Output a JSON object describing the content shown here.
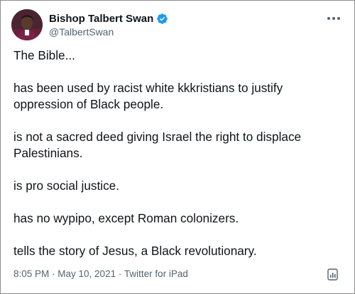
{
  "author": {
    "display_name": "Bishop Talbert Swan",
    "handle": "@TalbertSwan",
    "verified_icon": "verified-badge-icon",
    "verified_color": "#1d9bf0"
  },
  "tweet": {
    "paragraphs": [
      "The Bible...",
      "has been used by racist white kkkristians to justify oppression of Black people.",
      "is not a sacred deed giving Israel the right to displace Palestinians.",
      "is pro social justice.",
      "has no wypipo, except Roman colonizers.",
      "tells the story of Jesus, a Black revolutionary."
    ]
  },
  "meta": {
    "time": "8:05 PM",
    "separator": " · ",
    "date": "May 10, 2021",
    "source": "Twitter for iPad"
  },
  "icons": {
    "more": "more-options-icon",
    "analytics": "tweet-analytics-icon"
  },
  "colors": {
    "text_primary": "#0f1419",
    "text_secondary": "#536471",
    "border": "#8c8c8c"
  }
}
